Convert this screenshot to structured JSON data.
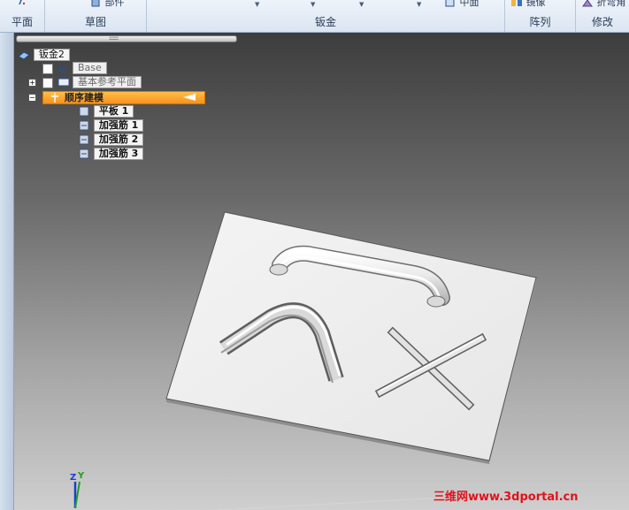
{
  "ribbon": {
    "groups": [
      {
        "label": "平面"
      },
      {
        "label": "草图",
        "tool": "部件"
      },
      {
        "label": "钣金"
      },
      {
        "label": "",
        "tool": "中面"
      },
      {
        "label": "阵列",
        "tool": "镜像"
      },
      {
        "label": "修改",
        "tool": "折弯角"
      }
    ]
  },
  "tree": {
    "root": "钣金2",
    "items": [
      {
        "label": "Base",
        "state": "grey"
      },
      {
        "label": "基本参考平面",
        "state": "grey"
      },
      {
        "label": "顺序建模",
        "state": "selected"
      },
      {
        "label": "平板 1"
      },
      {
        "label": "加强筋 1"
      },
      {
        "label": "加强筋 2"
      },
      {
        "label": "加强筋 3"
      }
    ]
  },
  "viewport": {
    "axis_labels": {
      "z": "Z",
      "y": "Y"
    },
    "watermark": "三维网www.3dportal.cn"
  },
  "colors": {
    "selection": "#f7921b",
    "watermark": "#e0121b",
    "axis_z": "#1a3fd8",
    "axis_y": "#1ea01e"
  }
}
